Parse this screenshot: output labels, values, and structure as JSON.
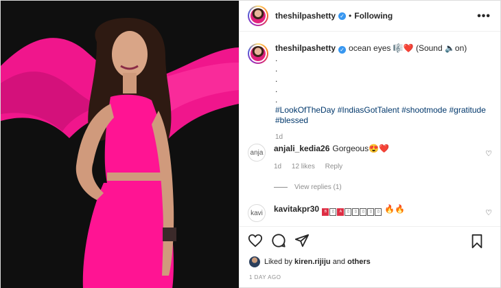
{
  "header": {
    "username": "theshilpashetty",
    "separator": "•",
    "follow_status": "Following",
    "more_label": "•••"
  },
  "caption": {
    "username": "theshilpashetty",
    "text": "ocean eyes 🎼❤️ (Sound 🔈on)",
    "dots": [
      ".",
      ".",
      ".",
      ".",
      "."
    ],
    "hashtags": "#LookOfTheDay #IndiasGotTalent #shootmode #gratitude #blessed",
    "time": "1d"
  },
  "comments": [
    {
      "avatar_text": "anja",
      "username": "anjali_kedia26",
      "text": "Gorgeous😍❤️",
      "time": "1d",
      "likes": "12 likes",
      "reply": "Reply"
    },
    {
      "avatar_text": "kavi",
      "username": "kavitakpr30",
      "text": "🔥🔥"
    }
  ],
  "view_replies": "View replies (1)",
  "likes": {
    "prefix": "Liked by",
    "user": "kiren.rijiju",
    "connector": "and",
    "others": "others"
  },
  "post_time": "1 DAY AGO",
  "colors": {
    "dress": "#ff1493",
    "background": "#0f0f0f",
    "link": "#00376b",
    "verified": "#3897f0"
  }
}
